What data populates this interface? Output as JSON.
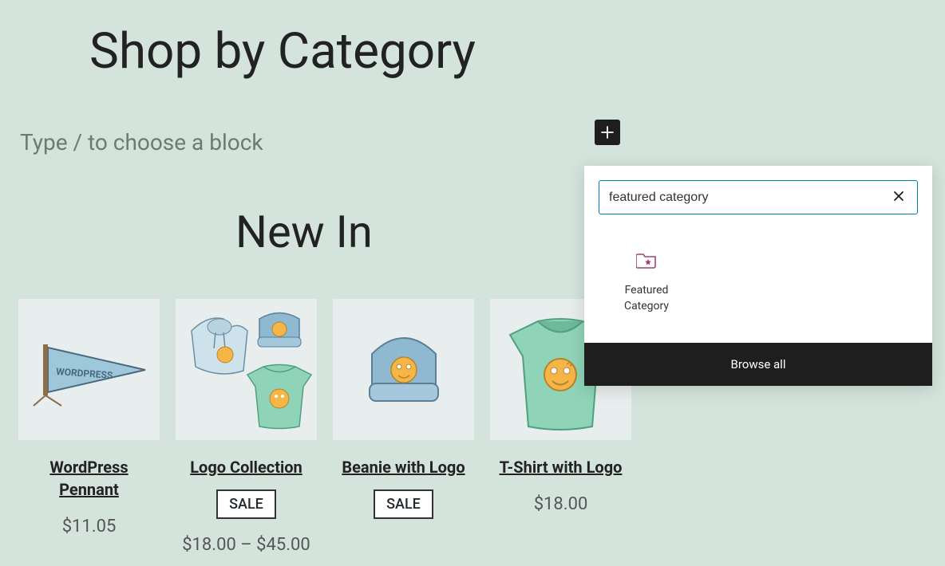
{
  "page_title": "Shop by Category",
  "block_placeholder": "Type / to choose a block",
  "section_title": "New In",
  "products": [
    {
      "name": "WordPress Pennant",
      "price": "$11.05",
      "sale": false
    },
    {
      "name": "Logo Collection",
      "price": "$18.00 – $45.00",
      "sale": true
    },
    {
      "name": "Beanie with Logo",
      "price": "",
      "sale": true
    },
    {
      "name": "T-Shirt with Logo",
      "price": "$18.00",
      "sale": false
    }
  ],
  "sale_label": "SALE",
  "inserter": {
    "search_value": "featured category",
    "result_label": "Featured Category",
    "browse_all": "Browse all"
  }
}
